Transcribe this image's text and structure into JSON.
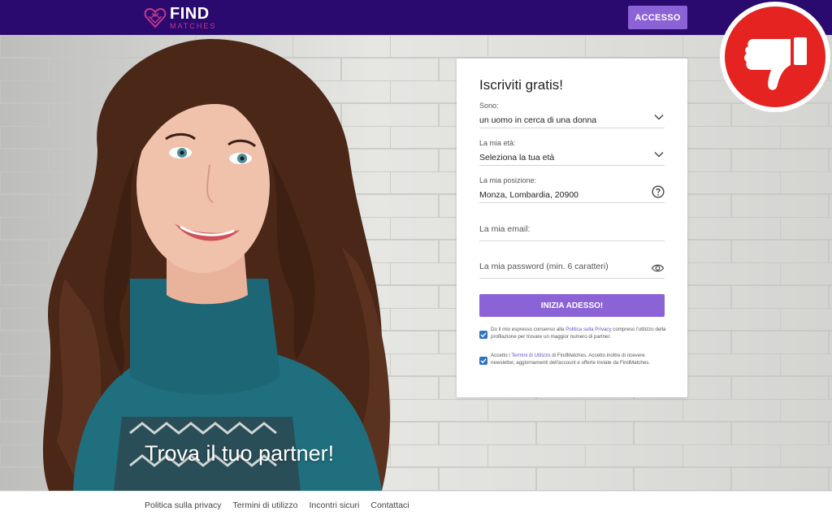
{
  "header": {
    "logo_find": "FIND",
    "logo_matches": "MATCHES",
    "login_label": "ACCESSO"
  },
  "hero": {
    "headline": "Trova il tuo partner!"
  },
  "signup": {
    "title": "Iscriviti gratis!",
    "fields": [
      {
        "label": "Sono:",
        "value": "un uomo in cerca di una donna"
      },
      {
        "label": "La mia età:",
        "value": "Seleziona la tua età"
      },
      {
        "label": "La mia posizione:",
        "value": "Monza, Lombardia, 20900"
      }
    ],
    "email_placeholder": "La mia email:",
    "password_placeholder": "La mia password (min. 6 caratteri)",
    "submit_label": "INIZIA ADESSO!",
    "consent_privacy": {
      "before": "Do il mio espresso consenso alla ",
      "link": "Politica sulla Privacy",
      "after": " compreso l'utilizzo della profilazione per trovare un maggior numero di partner.",
      "checked": true
    },
    "consent_terms": {
      "before": "Accetto i ",
      "link": "Termini di Utilizzo",
      "after": " di FindMatches. Accetto inoltre di ricevere newsletter, aggiornamenti dell'account e offerte inviate da FindMatches.",
      "checked": true
    }
  },
  "footer": {
    "links": [
      "Politica sulla privacy",
      "Termini di utilizzo",
      "Incontri sicuri",
      "Contattaci"
    ]
  },
  "colors": {
    "header_bg": "#2a0a6e",
    "accent": "#8c63d6",
    "badge_red": "#e52320"
  },
  "icons": [
    "logo-heart-icon",
    "chevron-down-icon",
    "help-circle-icon",
    "eye-icon",
    "check-icon",
    "thumbs-down-icon"
  ]
}
